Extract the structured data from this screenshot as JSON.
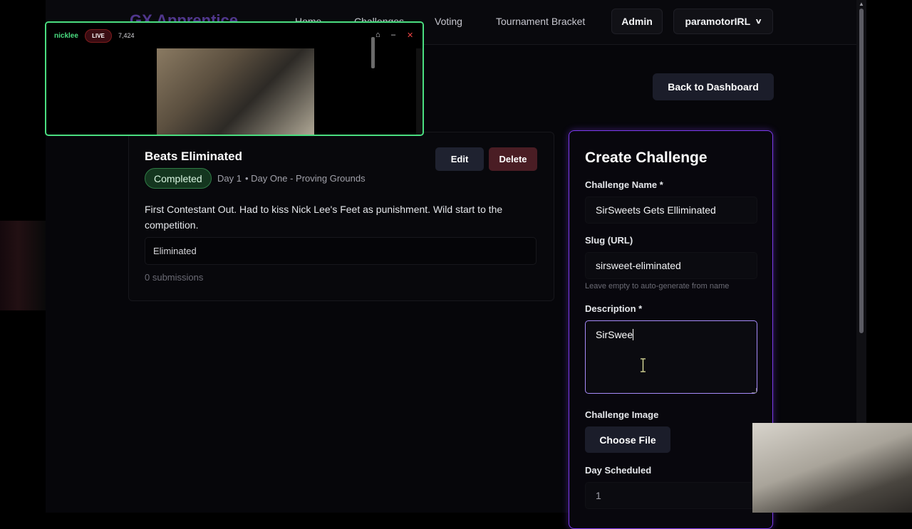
{
  "nav": {
    "brand": "GX Apprentice",
    "links": [
      "Home",
      "Challenges",
      "Voting",
      "Tournament Bracket"
    ],
    "admin_label": "Admin",
    "user_label": "paramotorIRL"
  },
  "header": {
    "back_label": "Back to Dashboard"
  },
  "challenge": {
    "title": "Beats Eliminated",
    "edit_label": "Edit",
    "delete_label": "Delete",
    "status": "Completed",
    "day": "Day 1",
    "phase": "• Day One - Proving Grounds",
    "description": "First Contestant Out. Had to kiss Nick Lee's Feet as punishment. Wild start to the competition.",
    "answer": "Eliminated",
    "submissions": "0 submissions"
  },
  "form": {
    "title": "Create Challenge",
    "name_label": "Challenge Name *",
    "name_value": "SirSweets Gets Elliminated",
    "slug_label": "Slug (URL)",
    "slug_value": "sirsweet-eliminated",
    "slug_hint": "Leave empty to auto-generate from name",
    "description_label": "Description *",
    "description_value": "SirSwee",
    "image_label": "Challenge Image",
    "file_button": "Choose File",
    "day_label": "Day Scheduled",
    "day_value": "1"
  },
  "stream": {
    "channel": "nicklee",
    "live_label": "LIVE",
    "viewers": "7,424",
    "accent": "#4ade80"
  },
  "icons": [
    "home-icon",
    "minimize-icon",
    "close-icon",
    "chevron-down-icon",
    "text-cursor-icon"
  ]
}
